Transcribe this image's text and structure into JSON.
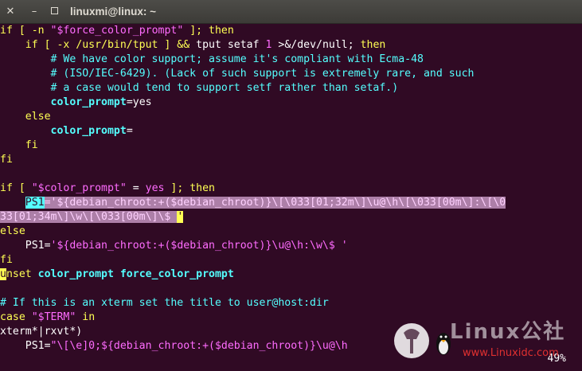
{
  "window": {
    "title": "linuxmi@linux: ~",
    "close_icon": "close-icon",
    "min_icon": "minimize-icon",
    "max_icon": "maximize-icon"
  },
  "lines": {
    "l1": [
      "if [ -n \"",
      "$force_color_prompt",
      "\" ]; then"
    ],
    "l2": [
      "    if [ -x /usr/bin/tput ] && tput setaf ",
      "1",
      " >&/dev/null; then"
    ],
    "l3": "        # We have color support; assume it's compliant with Ecma-48",
    "l4": "        # (ISO/IEC-6429). (Lack of such support is extremely rare, and such",
    "l5": "        # a case would tend to support setf rather than setaf.)",
    "l6": [
      "        ",
      "color_prompt",
      "=yes"
    ],
    "l7": "    else",
    "l8": [
      "        ",
      "color_prompt",
      "="
    ],
    "l9": "    fi",
    "l10": "fi",
    "l11": "",
    "l12": [
      "if [ \"",
      "$color_prompt",
      "\" = ",
      "yes",
      " ]; then"
    ],
    "l13": [
      "    ",
      "PS1",
      "=",
      "'${debian_chroot:+($debian_chroot)}\\[\\033[01;32m\\]\\u@\\h\\[\\033[00m\\]:\\[\\0"
    ],
    "l14": [
      "33[01;34m\\]\\w\\[\\033[00m\\]\\$ ",
      "'"
    ],
    "l15": "else",
    "l16": [
      "    PS1=",
      "'${debian_chroot:+($debian_chroot)}\\u@\\h:\\w\\$ '"
    ],
    "l17": "fi",
    "l18": [
      "u",
      "nset ",
      "color_prompt force_color_prompt"
    ],
    "l19": "",
    "l20": "# If this is an xterm set the title to user@host:dir",
    "l21": [
      "case \"",
      "$TERM",
      "\" in"
    ],
    "l22": "xterm*|rxvt*)",
    "l23": [
      "    PS1=",
      "\"\\[\\e]0;${debian_chroot:+($debian_chroot)}\\u@\\h"
    ]
  },
  "status": "49%",
  "watermark": {
    "text": "Linux公社",
    "url": "www.Linuxidc.com"
  },
  "colors": {
    "background": "#300a24",
    "keyword": "#ffff54",
    "string": "#ff6cff",
    "comment": "#54ffff",
    "selection": "#ad7fa8"
  }
}
